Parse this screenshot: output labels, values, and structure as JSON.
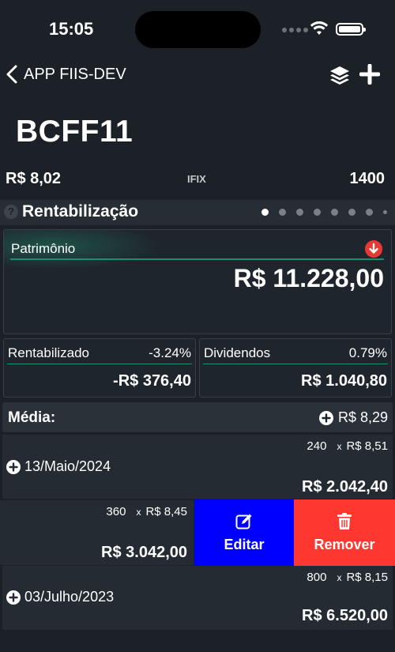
{
  "status_bar": {
    "time": "15:05"
  },
  "nav": {
    "back_label": "APP FIIS-DEV"
  },
  "header": {
    "ticker": "BCFF11",
    "price": "R$ 8,02",
    "index_label": "IFIX",
    "index_value": "1400"
  },
  "section": {
    "help_glyph": "?",
    "title": "Rentabilização",
    "pages": 8,
    "active_page": 0
  },
  "patrimonio": {
    "label": "Patrimônio",
    "value": "R$ 11.228,00"
  },
  "rentabilizado": {
    "label": "Rentabilizado",
    "percent": "-3.24%",
    "value": "-R$ 376,40"
  },
  "dividendos": {
    "label": "Dividendos",
    "percent": "0.79%",
    "value": "R$ 1.040,80"
  },
  "media": {
    "label": "Média:",
    "value": "R$ 8,29"
  },
  "entries": [
    {
      "date": "13/Maio/2024",
      "qty": "240",
      "x": "x",
      "unit_price": "R$ 8,51",
      "total": "R$ 2.042,40"
    },
    {
      "qty": "360",
      "x": "x",
      "unit_price": "R$ 8,45",
      "total": "R$ 3.042,00"
    },
    {
      "date": "03/Julho/2023",
      "qty": "800",
      "x": "x",
      "unit_price": "R$ 8,15",
      "total": "R$ 6.520,00"
    }
  ],
  "actions": {
    "edit_label": "Editar",
    "remove_label": "Remover"
  },
  "colors": {
    "background": "#1c2128",
    "accent_green": "#1b8e70",
    "edit_blue": "#0000fe",
    "remove_red": "#fe3830",
    "alert_red": "#e53935"
  },
  "icons": [
    "back-chevron-icon",
    "layers-icon",
    "plus-icon",
    "help-icon",
    "arrow-down-circle-icon",
    "plus-circle-icon",
    "edit-icon",
    "trash-icon",
    "wifi-icon",
    "battery-icon"
  ]
}
